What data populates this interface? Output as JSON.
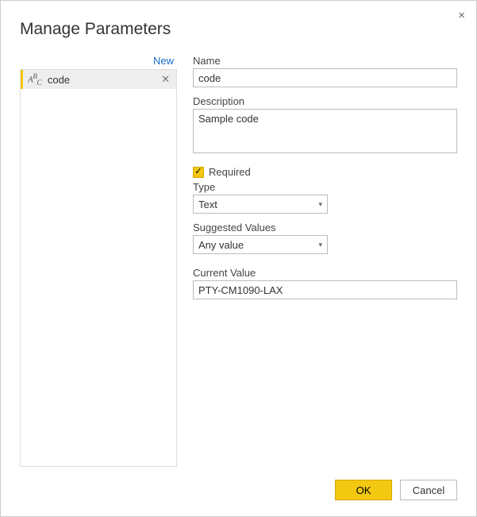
{
  "dialog": {
    "title": "Manage Parameters",
    "close_icon": "×"
  },
  "left": {
    "new_label": "New",
    "items": [
      {
        "name": "code"
      }
    ],
    "delete_icon": "✕"
  },
  "form": {
    "name_label": "Name",
    "name_value": "code",
    "description_label": "Description",
    "description_value": "Sample code",
    "required_label": "Required",
    "required_checked": true,
    "type_label": "Type",
    "type_value": "Text",
    "suggested_label": "Suggested Values",
    "suggested_value": "Any value",
    "current_label": "Current Value",
    "current_value": "PTY-CM1090-LAX"
  },
  "footer": {
    "ok_label": "OK",
    "cancel_label": "Cancel"
  }
}
